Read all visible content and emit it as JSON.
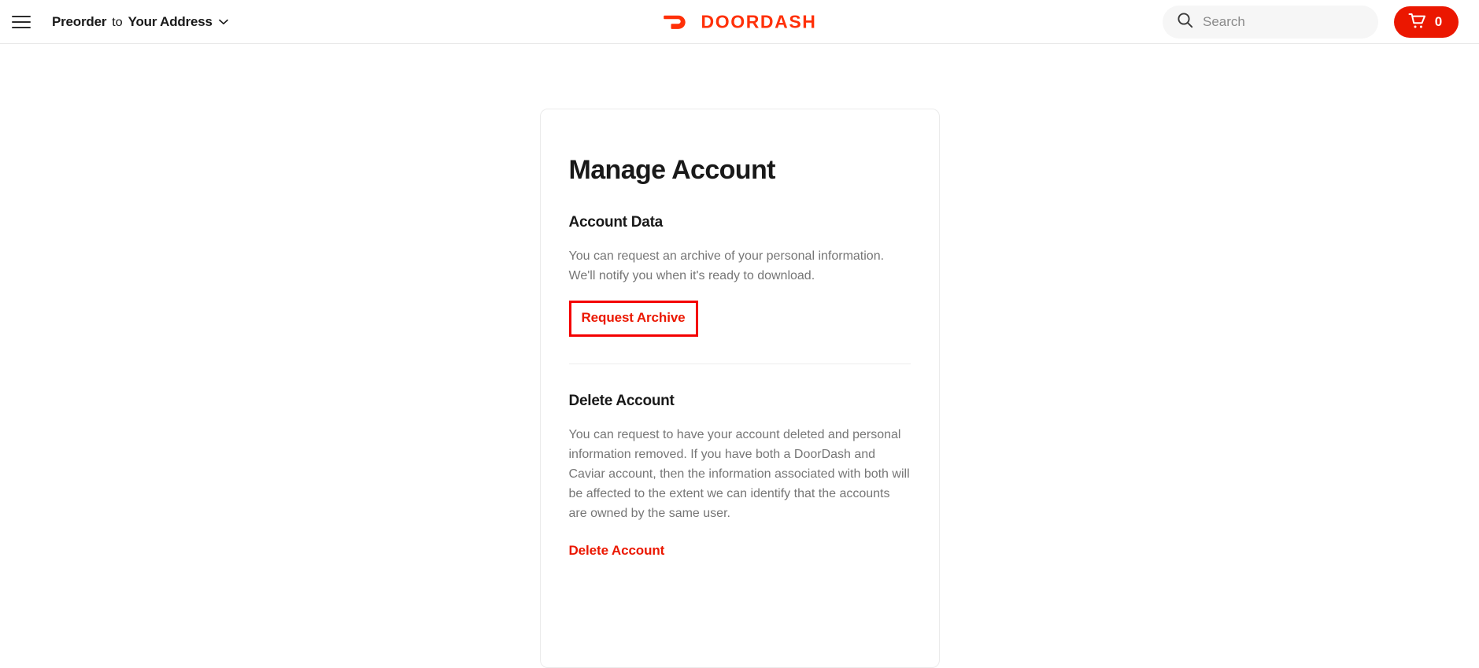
{
  "header": {
    "menu_icon": "hamburger-menu-icon",
    "mode_label": "Preorder",
    "to_label": "to",
    "address_label": "Your Address",
    "chevron_icon": "chevron-down-icon",
    "brand": "DOORDASH",
    "logo_icon": "doordash-dash-logo",
    "search": {
      "icon": "search-icon",
      "placeholder": "Search",
      "value": ""
    },
    "cart": {
      "icon": "shopping-cart-icon",
      "count": "0"
    },
    "brand_color": "#ff3008",
    "cart_color": "#eb1700"
  },
  "main": {
    "page_title": "Manage Account",
    "sections": [
      {
        "title": "Account Data",
        "body": "You can request an archive of your personal information. We'll notify you when it's ready to download.",
        "action_label": "Request Archive",
        "highlighted": true
      },
      {
        "title": "Delete Account",
        "body": "You can request to have your account deleted and personal information removed. If you have both a DoorDash and Caviar account, then the information associated with both will be affected to the extent we can identify that the accounts are owned by the same user.",
        "action_label": "Delete Account",
        "highlighted": false
      }
    ],
    "highlight_color": "#f40000",
    "link_color": "#eb1700"
  }
}
